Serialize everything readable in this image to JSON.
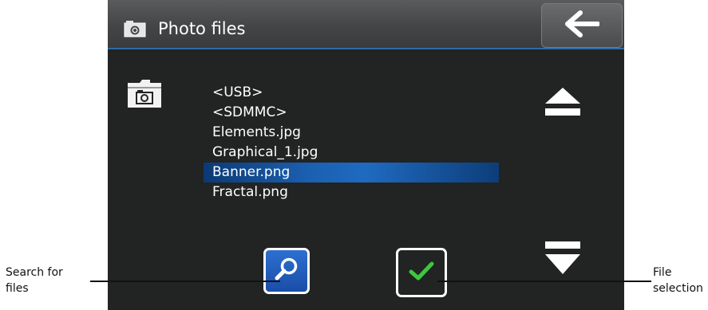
{
  "window": {
    "title": "Photo files",
    "title_icon": "camera-icon",
    "back_icon": "arrow-left-icon"
  },
  "folder_icon": "camera-folder-icon",
  "file_list": {
    "items": [
      "<USB>",
      "<SDMMC>",
      "Elements.jpg",
      "Graphical_1.jpg",
      "Banner.png",
      "Fractal.png"
    ],
    "selected": "Banner.png"
  },
  "controls": {
    "scroll_up_icon": "eject-up-icon",
    "scroll_down_icon": "eject-down-icon",
    "search_icon": "magnifier-icon",
    "select_icon": "checkmark-icon"
  },
  "annotations": {
    "search_line1": "Search for",
    "search_line2": "files",
    "select_line1": "File",
    "select_line2": "selection"
  },
  "colors": {
    "background": "#222323",
    "accent_blue": "#1f6ac0",
    "check_green": "#3cc83c"
  }
}
